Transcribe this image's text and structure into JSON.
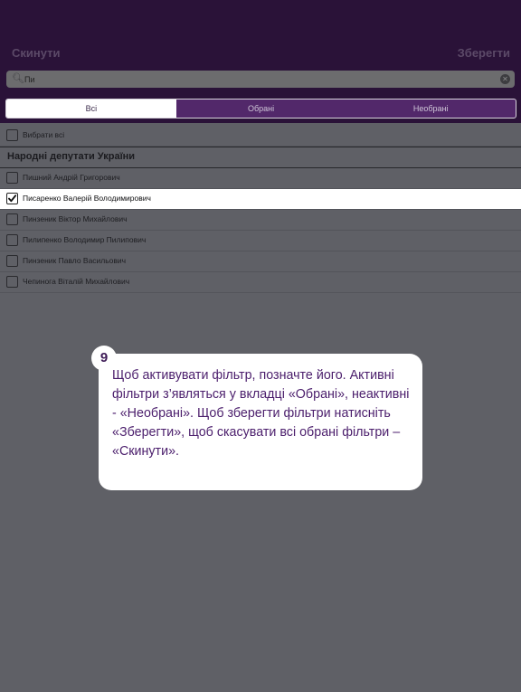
{
  "header": {
    "reset_label": "Скинути",
    "save_label": "Зберегти"
  },
  "search": {
    "value": "Пи",
    "placeholder": ""
  },
  "tabs": [
    {
      "label": "Всі",
      "active": true
    },
    {
      "label": "Обрані",
      "active": false
    },
    {
      "label": "Необрані",
      "active": false
    }
  ],
  "list": {
    "select_all_label": "Вибрати всі",
    "section_title": "Народні депутати України",
    "items": [
      {
        "label": "Пишний Андрій Григорович",
        "checked": false
      },
      {
        "label": "Писаренко Валерій Володимирович",
        "checked": true
      },
      {
        "label": "Пинзеник Віктор Михайлович",
        "checked": false
      },
      {
        "label": "Пилипенко Володимир Пилипович",
        "checked": false
      },
      {
        "label": "Пинзеник Павло Васильович",
        "checked": false
      },
      {
        "label": "Чепинога Віталій Михайлович",
        "checked": false
      }
    ]
  },
  "callout": {
    "number": "9",
    "text": "Щоб активувати фільтр, позначте його. Активні фільтри з’являться у вкладці «Обрані», неактивні - «Необрані». Щоб зберегти фільтри натисніть «Зберегти», щоб скасувати всі обрані фільтри – «Скинути»."
  },
  "colors": {
    "top_bar": "#2a1238",
    "accent": "#52286a",
    "overlay": "#5f6066"
  }
}
